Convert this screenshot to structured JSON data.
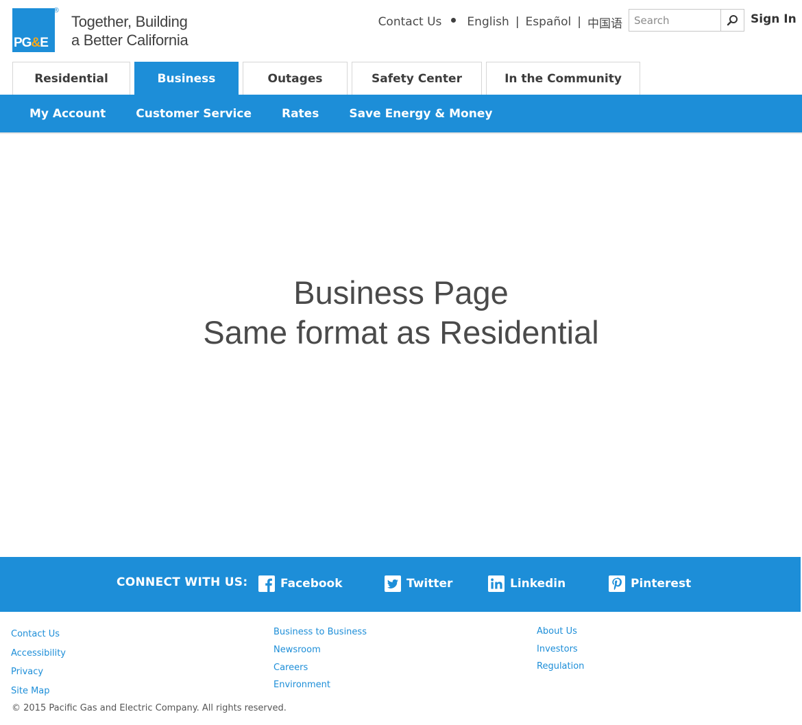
{
  "header": {
    "logo_text_a": "PG",
    "logo_text_b": "&",
    "logo_text_c": "E",
    "logo_reg": "®",
    "tagline_line1": "Together, Building",
    "tagline_line2": "a Better California",
    "contact_label": "Contact Us",
    "lang_english": "English",
    "lang_sep": "|",
    "lang_espanol": "Español",
    "lang_chinese": "中国语",
    "search_placeholder": "Search",
    "sign_in_label": "Sign In"
  },
  "tabs": [
    {
      "label": "Residential"
    },
    {
      "label": "Business"
    },
    {
      "label": "Outages"
    },
    {
      "label": "Safety Center"
    },
    {
      "label": "In the Community"
    }
  ],
  "subnav": [
    {
      "label": "My Account"
    },
    {
      "label": "Customer Service"
    },
    {
      "label": "Rates"
    },
    {
      "label": "Save Energy & Money"
    }
  ],
  "hero": {
    "line1": "Business Page",
    "line2": "Same format as Residential"
  },
  "connect": {
    "label": "CONNECT WITH US:",
    "facebook": "Facebook",
    "twitter": "Twitter",
    "linkedin": "Linkedin",
    "pinterest": "Pinterest"
  },
  "footer": {
    "col1": [
      "Contact Us",
      "Accessibility",
      "Privacy",
      "Site Map"
    ],
    "col2": [
      "Business to Business",
      "Newsroom",
      "Careers",
      "Environment"
    ],
    "col3": [
      "About Us",
      "Investors",
      "Regulation"
    ],
    "copyright": "© 2015  Pacific Gas and Electric Company. All rights reserved."
  },
  "colors": {
    "brand_blue": "#1d8ed8",
    "logo_orange": "#f5a81c"
  },
  "icons": {
    "search": "search-icon",
    "facebook": "facebook-icon",
    "twitter": "twitter-icon",
    "linkedin": "linkedin-icon",
    "pinterest": "pinterest-icon"
  }
}
